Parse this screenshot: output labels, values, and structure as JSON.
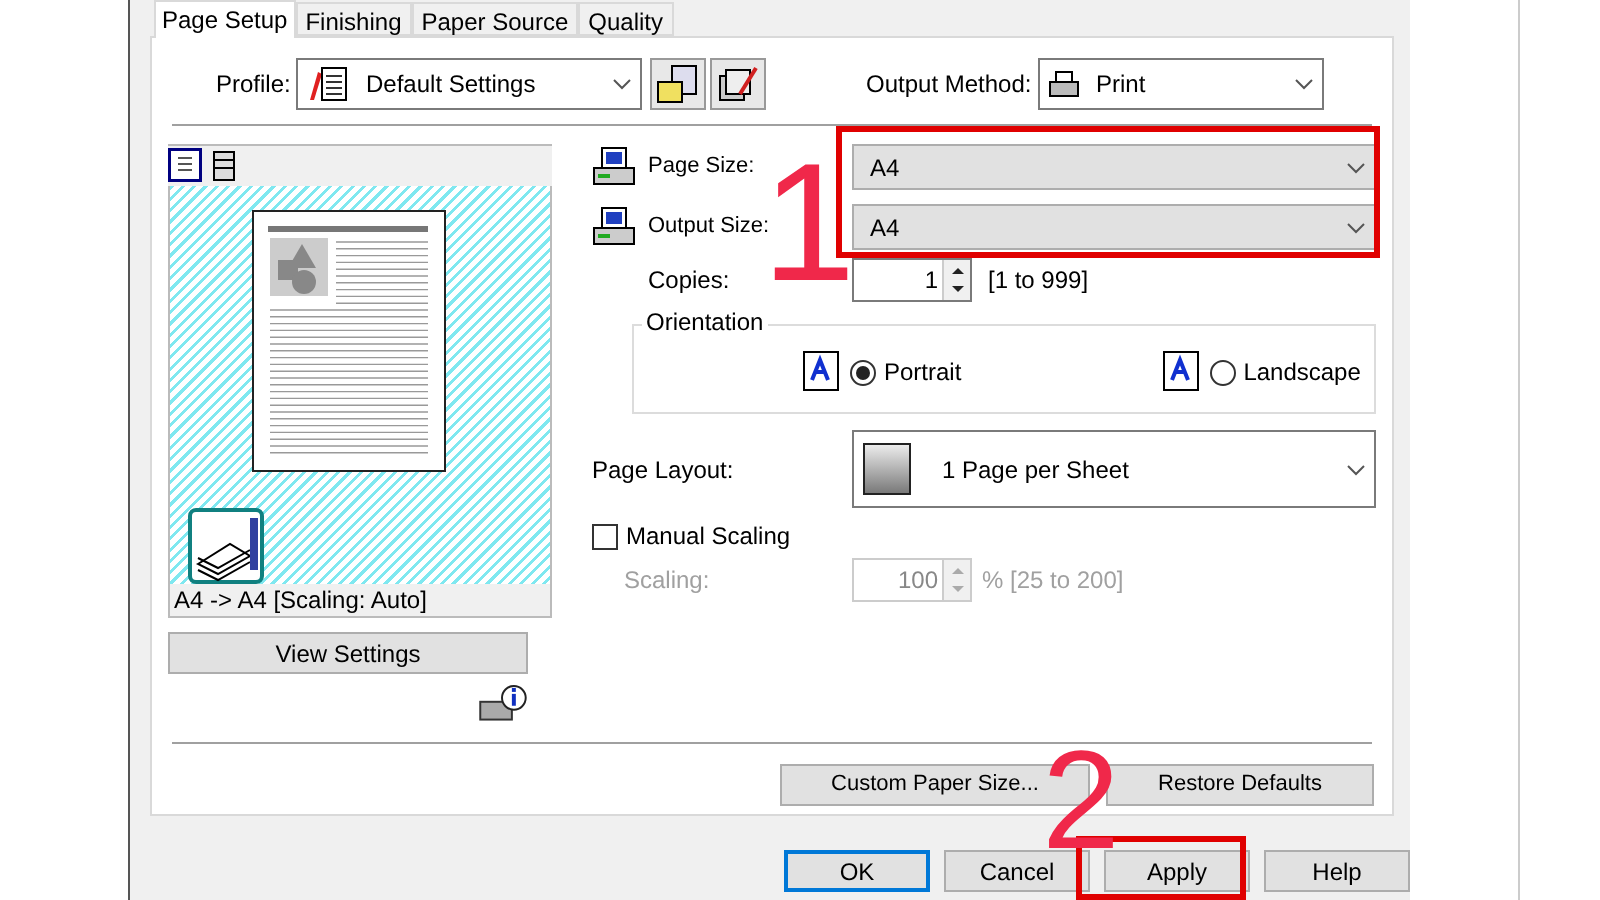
{
  "tabs": [
    {
      "label": "Page Setup",
      "selected": true
    },
    {
      "label": "Finishing",
      "selected": false
    },
    {
      "label": "Paper Source",
      "selected": false
    },
    {
      "label": "Quality",
      "selected": false
    }
  ],
  "profile": {
    "label": "Profile:",
    "value": "Default Settings"
  },
  "output_method": {
    "label": "Output Method:",
    "value": "Print"
  },
  "preview": {
    "caption": "A4 -> A4 [Scaling: Auto]",
    "view_settings_button": "View Settings"
  },
  "page_size": {
    "label": "Page Size:",
    "value": "A4"
  },
  "output_size": {
    "label": "Output Size:",
    "value": "A4"
  },
  "copies": {
    "label": "Copies:",
    "value": "1",
    "range": "[1 to 999]"
  },
  "orientation": {
    "title": "Orientation",
    "options": [
      {
        "label": "Portrait",
        "selected": true
      },
      {
        "label": "Landscape",
        "selected": false
      }
    ]
  },
  "page_layout": {
    "label": "Page Layout:",
    "value": "1 Page per Sheet"
  },
  "manual_scaling": {
    "label": "Manual Scaling",
    "checked": false
  },
  "scaling": {
    "label": "Scaling:",
    "value": "100",
    "range": "% [25 to 200]",
    "disabled": true
  },
  "panel_buttons": [
    "Custom Paper Size...",
    "Restore Defaults"
  ],
  "dialog_buttons": [
    {
      "label": "OK",
      "default": true
    },
    {
      "label": "Cancel",
      "default": false
    },
    {
      "label": "Apply",
      "default": false
    },
    {
      "label": "Help",
      "default": false
    }
  ],
  "annotations": [
    {
      "text": "1"
    },
    {
      "text": "2"
    }
  ]
}
